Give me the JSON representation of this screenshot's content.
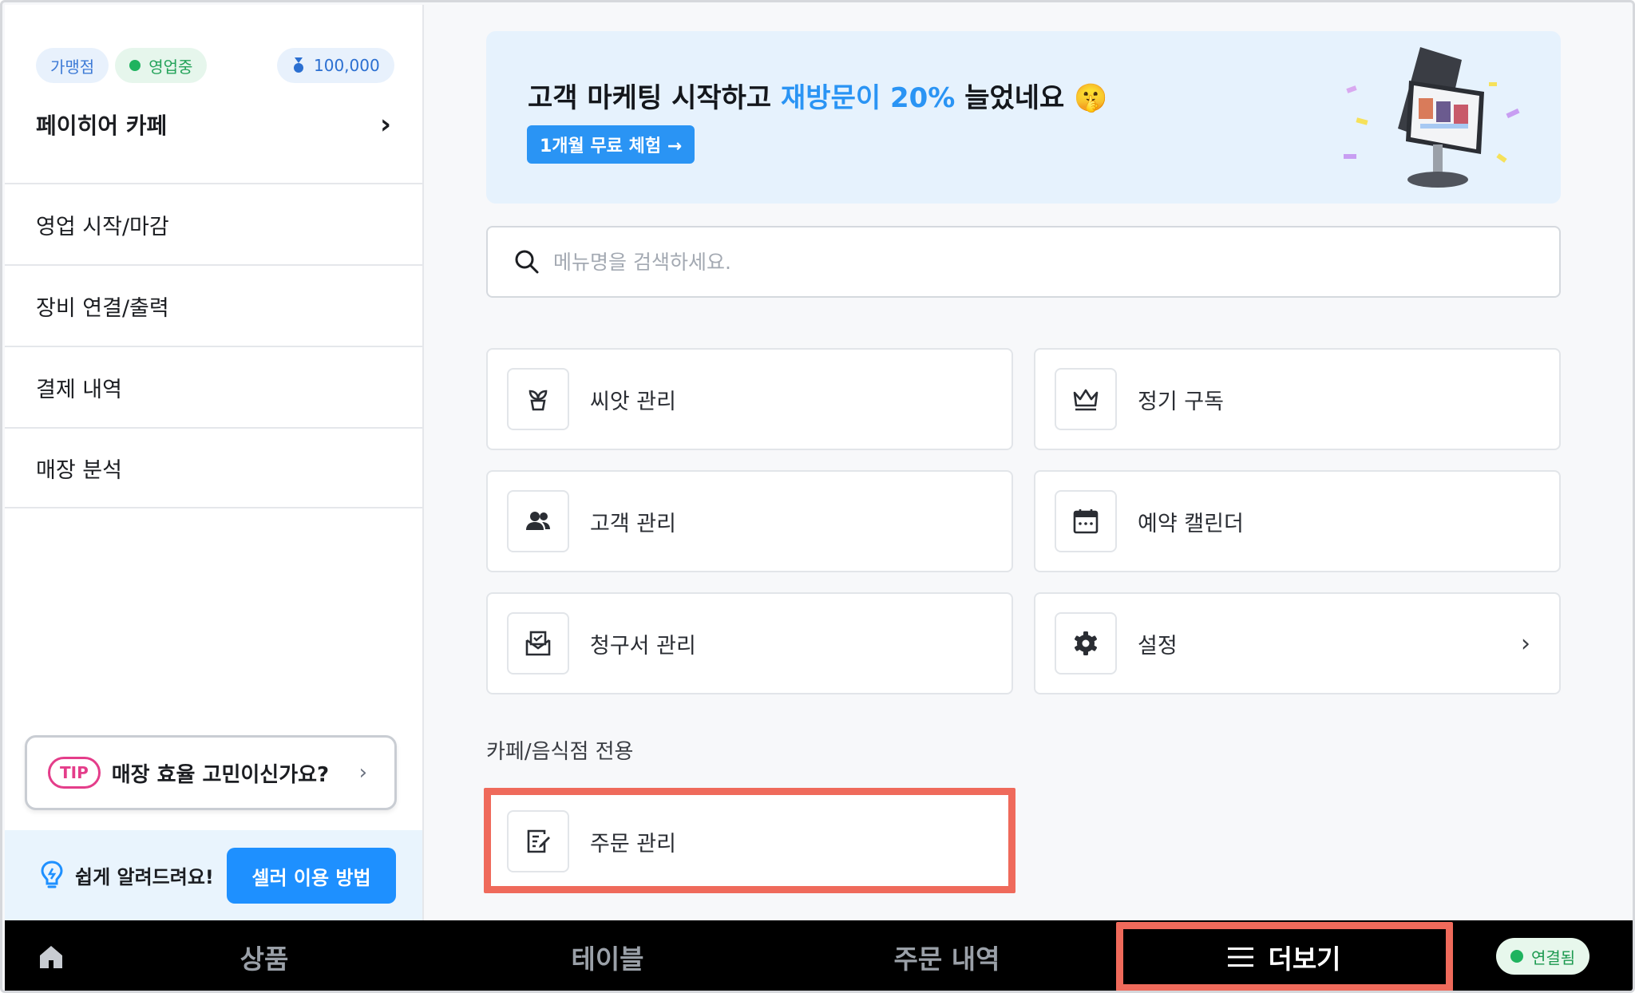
{
  "sidebar": {
    "badges": {
      "store_type": "가맹점",
      "status": "영업중",
      "points": "100,000"
    },
    "store_name": "페이히어 카페",
    "menu": [
      {
        "label": "영업 시작/마감"
      },
      {
        "label": "장비 연결/출력"
      },
      {
        "label": "결제 내역"
      },
      {
        "label": "매장 분석"
      }
    ],
    "tip": {
      "pill": "TIP",
      "text": "매장 효율 고민이신가요?"
    },
    "help": {
      "text": "쉽게 알려드려요!",
      "button": "셀러 이용 방법"
    }
  },
  "banner": {
    "title_prefix": "고객 마케팅 시작하고 ",
    "title_highlight": "재방문이 20%",
    "title_suffix": " 늘었네요 ",
    "emoji": "🤫",
    "button": "1개월 무료 체험 →"
  },
  "search": {
    "placeholder": "메뉴명을 검색하세요."
  },
  "cards": [
    {
      "label": "씨앗 관리",
      "icon": "sprout-icon"
    },
    {
      "label": "정기 구독",
      "icon": "crown-icon"
    },
    {
      "label": "고객 관리",
      "icon": "users-icon"
    },
    {
      "label": "예약 캘린더",
      "icon": "calendar-icon"
    },
    {
      "label": "청구서 관리",
      "icon": "invoice-mail-icon"
    },
    {
      "label": "설정",
      "icon": "gear-icon"
    }
  ],
  "section": {
    "title": "카페/음식점 전용",
    "order_card": {
      "label": "주문 관리",
      "icon": "order-edit-icon"
    }
  },
  "bottom_nav": {
    "items": [
      {
        "label": "상품"
      },
      {
        "label": "테이블"
      },
      {
        "label": "주문 내역"
      },
      {
        "label": "더보기"
      }
    ],
    "connection": "연결됨"
  },
  "colors": {
    "accent": "#1e90ff",
    "highlight": "#ef6a5b",
    "online": "#1fb35f",
    "tip": "#e43d8a"
  }
}
